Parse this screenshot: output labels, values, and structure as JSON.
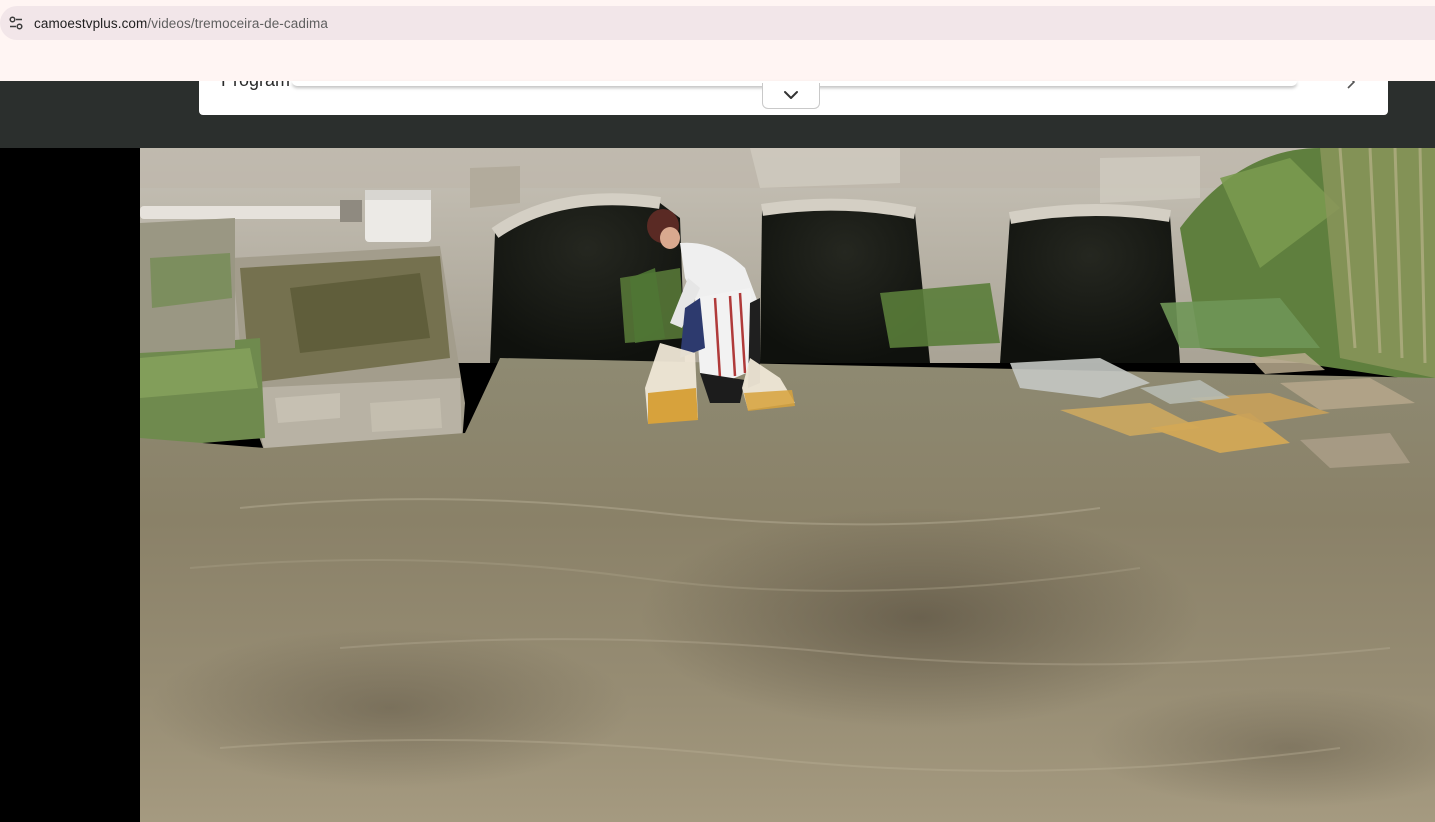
{
  "browser": {
    "url_domain": "camoestvplus.com",
    "url_path": "/videos/tremoceira-de-cadima",
    "site_info_icon": "tune-icon"
  },
  "site_header": {
    "program_label": "Program",
    "expand_icon": "chevron-down-icon",
    "next_icon": "chevron-right-icon"
  },
  "video": {
    "scene": "woman-washing-lupins-in-stream"
  },
  "colors": {
    "header_bg": "#2b2f2d",
    "address_bar_bg": "#f2e6e9",
    "browser_bg": "#fff5f3"
  }
}
